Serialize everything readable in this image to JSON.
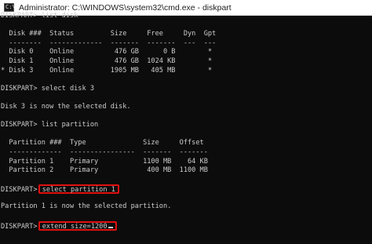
{
  "window": {
    "title": "Administrator: C:\\WINDOWS\\system32\\cmd.exe - diskpart",
    "icon": "cmd-icon"
  },
  "console": {
    "l01": "DISKPART> list disk",
    "l02": "",
    "l03": "  Disk ###  Status         Size     Free     Dyn  Gpt",
    "l04": "  --------  -------------  -------  -------  ---  ---",
    "l05": "  Disk 0    Online          476 GB      0 B        *",
    "l06": "  Disk 1    Online          476 GB  1024 KB        *",
    "l07": "* Disk 3    Online         1905 MB   405 MB        *",
    "l08": "",
    "l09": "DISKPART> select disk 3",
    "l10": "",
    "l11": "Disk 3 is now the selected disk.",
    "l12": "",
    "l13": "DISKPART> list partition",
    "l14": "",
    "l15": "  Partition ###  Type              Size     Offset",
    "l16": "  -------------  ----------------  -------  -------",
    "l17": "  Partition 1    Primary           1100 MB    64 KB",
    "l18": "  Partition 2    Primary            400 MB  1100 MB",
    "l19": "",
    "l20_prompt": "DISKPART> ",
    "l20_cmd": "select partition 1",
    "l21": "",
    "l22": "Partition 1 is now the selected partition.",
    "l23": "",
    "l24_prompt": "DISKPART> ",
    "l24_cmd": "extend size=1200"
  },
  "colors": {
    "background": "#0c0c0c",
    "text": "#cccccc",
    "highlight": "#e01010"
  }
}
